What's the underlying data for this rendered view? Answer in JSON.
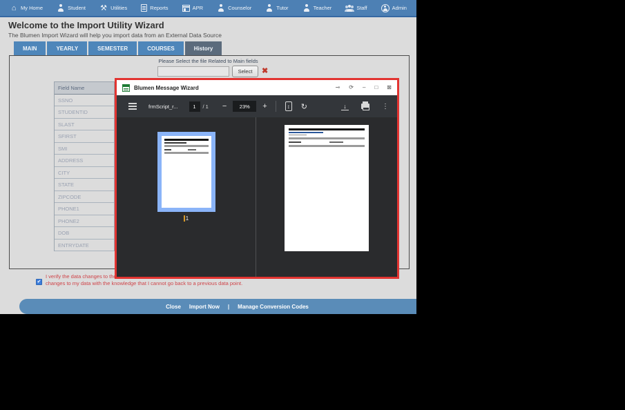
{
  "nav": {
    "items": [
      {
        "label": "My Home",
        "icon": "home"
      },
      {
        "label": "Student",
        "icon": "person"
      },
      {
        "label": "Utilities",
        "icon": "tools"
      },
      {
        "label": "Reports",
        "icon": "report"
      },
      {
        "label": "APR",
        "icon": "window"
      },
      {
        "label": "Counselor",
        "icon": "person"
      },
      {
        "label": "Tutor",
        "icon": "person"
      },
      {
        "label": "Teacher",
        "icon": "person"
      },
      {
        "label": "Staff",
        "icon": "people"
      },
      {
        "label": "Admin",
        "icon": "person-circle"
      }
    ]
  },
  "header": {
    "title": "Welcome to the Import Utility Wizard",
    "subtitle": "The Blumen Import Wizard will help you import data from an External Data Source"
  },
  "tabs": [
    {
      "label": "MAIN",
      "active": false
    },
    {
      "label": "YEARLY",
      "active": false
    },
    {
      "label": "SEMESTER",
      "active": false
    },
    {
      "label": "COURSES",
      "active": false
    },
    {
      "label": "History",
      "active": true
    }
  ],
  "file_select": {
    "prompt": "Please Select the file Related to Main fields",
    "input_value": "",
    "select_button": "Select",
    "remove_icon": "✖"
  },
  "field_table": {
    "header": "Field Name",
    "rows": [
      "SSNO",
      "STUDENTID",
      "SLAST",
      "SFIRST",
      "SMI",
      "ADDRESS",
      "CITY",
      "STATE",
      "ZIPCODE",
      "PHONE1",
      "PHONE2",
      "DOB",
      "ENTRYDATE"
    ]
  },
  "verify": {
    "checked": true,
    "check_glyph": "✔",
    "line1": "I verify the data changes to the",
    "line2": "changes to my data with the knowledge that I cannot go back to a previous data point."
  },
  "footer": {
    "close": "Close",
    "import_now": "Import Now",
    "separator": "|",
    "manage": "Manage Conversion Codes"
  },
  "modal": {
    "title": "Blumen Message Wizard",
    "window_controls": {
      "pin": "⊸",
      "refresh": "⟳",
      "minimize": "–",
      "maximize": "□",
      "close": "⊠"
    },
    "toolbar": {
      "filename": "frmScript_r...",
      "page_current": "1",
      "page_total": "/ 1",
      "zoom_out": "−",
      "zoom_level": "23%",
      "zoom_in": "+",
      "fit_glyph": "↕",
      "rotate_glyph": "↻",
      "download_glyph": "↓",
      "more_glyph": "⋮"
    },
    "thumbnail_page_number": "1"
  },
  "colors": {
    "nav_blue": "#4d80b4",
    "tab_blue": "#4e86ba",
    "active_tab_gray": "#5b6b7c",
    "footer_blue": "#5a8cb8",
    "alert_red_border": "#e23431",
    "verify_text_red": "#cf4449",
    "checkbox_blue": "#3d7edb",
    "toolbar_dark": "#33363a",
    "viewer_dark": "#2a2b2d",
    "thumb_selection_blue": "#8ab4f8",
    "page_bg_gray": "#dcdcdc"
  }
}
